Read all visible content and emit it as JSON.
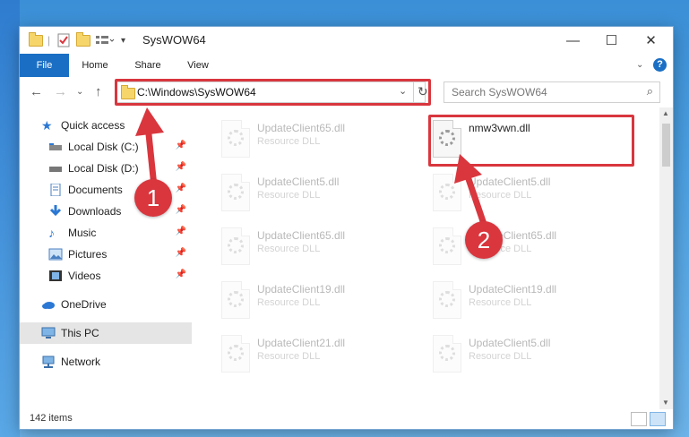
{
  "window": {
    "title": "SysWOW64"
  },
  "ribbon": {
    "tabs": [
      {
        "label": "File"
      },
      {
        "label": "Home"
      },
      {
        "label": "Share"
      },
      {
        "label": "View"
      }
    ]
  },
  "address": {
    "path": "C:\\Windows\\SysWOW64"
  },
  "search": {
    "placeholder": "Search SysWOW64"
  },
  "nav": {
    "items": [
      {
        "label": "Quick access"
      },
      {
        "label": "Local Disk (C:)"
      },
      {
        "label": "Local Disk (D:)"
      },
      {
        "label": "Documents"
      },
      {
        "label": "Downloads"
      },
      {
        "label": "Music"
      },
      {
        "label": "Pictures"
      },
      {
        "label": "Videos"
      },
      {
        "label": "OneDrive"
      },
      {
        "label": "This PC"
      },
      {
        "label": "Network"
      }
    ]
  },
  "files": [
    {
      "name": "UpdateClient65.dll",
      "type": "Resource DLL"
    },
    {
      "name": "nmw3vwn.dll",
      "type": ""
    },
    {
      "name": "UpdateClient5.dll",
      "type": "Resource DLL"
    },
    {
      "name": "UpdateClient5.dll",
      "type": "Resource DLL"
    },
    {
      "name": "UpdateClient65.dll",
      "type": "Resource DLL"
    },
    {
      "name": "UpdateClient65.dll",
      "type": "Resource DLL"
    },
    {
      "name": "UpdateClient19.dll",
      "type": "Resource DLL"
    },
    {
      "name": "UpdateClient19.dll",
      "type": "Resource DLL"
    },
    {
      "name": "UpdateClient21.dll",
      "type": "Resource DLL"
    },
    {
      "name": "UpdateClient5.dll",
      "type": "Resource DLL"
    }
  ],
  "status": {
    "items": "142 items"
  },
  "annotations": {
    "one": "1",
    "two": "2",
    "color": "#d9363e"
  }
}
